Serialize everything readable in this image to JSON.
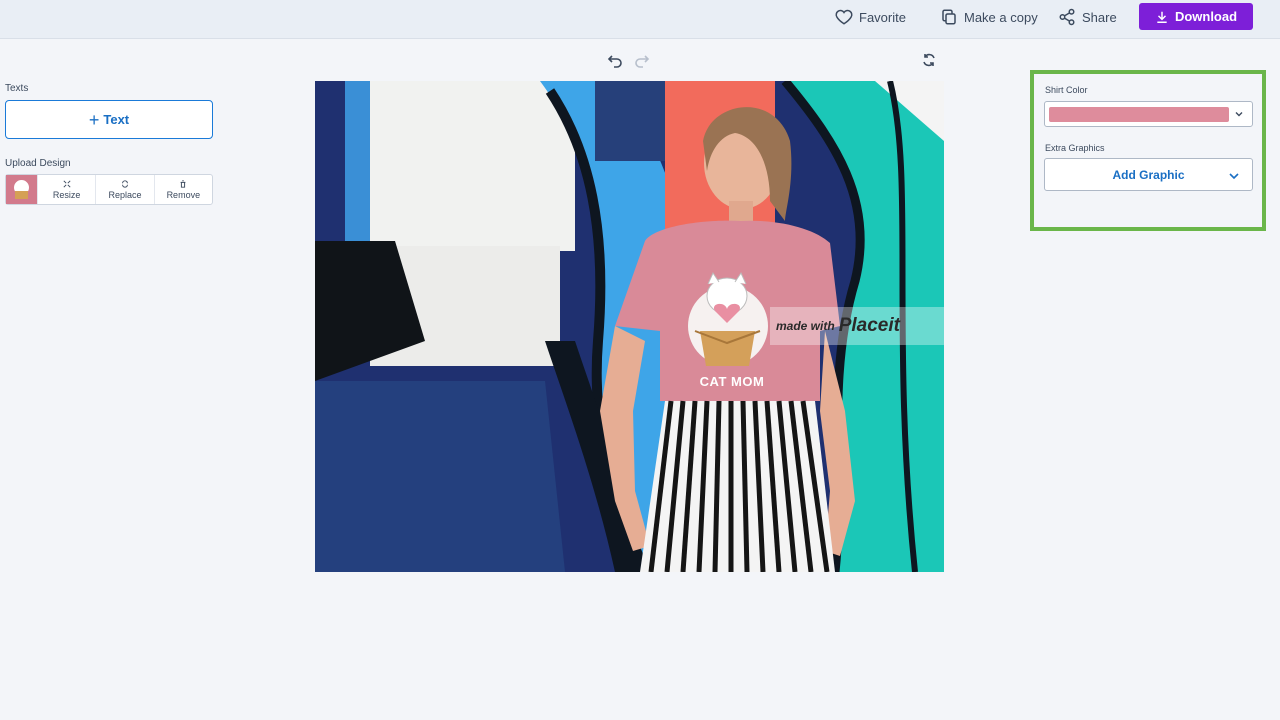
{
  "topbar": {
    "favorite_label": "Favorite",
    "copy_label": "Make a copy",
    "share_label": "Share",
    "download_label": "Download",
    "accent_color": "#7d1fd8"
  },
  "left_panel": {
    "texts_label": "Texts",
    "add_text_label": "Text",
    "upload_label": "Upload Design",
    "tools": [
      "Resize",
      "Replace",
      "Remove"
    ]
  },
  "mockup": {
    "shirt_print": "CAT MOM",
    "watermark_small": "made with",
    "watermark_big": "Placeit"
  },
  "right_panel": {
    "shirt_color_label": "Shirt Color",
    "shirt_color_value": "#de8c9c",
    "extra_graphics_label": "Extra Graphics",
    "add_graphic_label": "Add Graphic",
    "highlight_color": "#6ab64a"
  }
}
